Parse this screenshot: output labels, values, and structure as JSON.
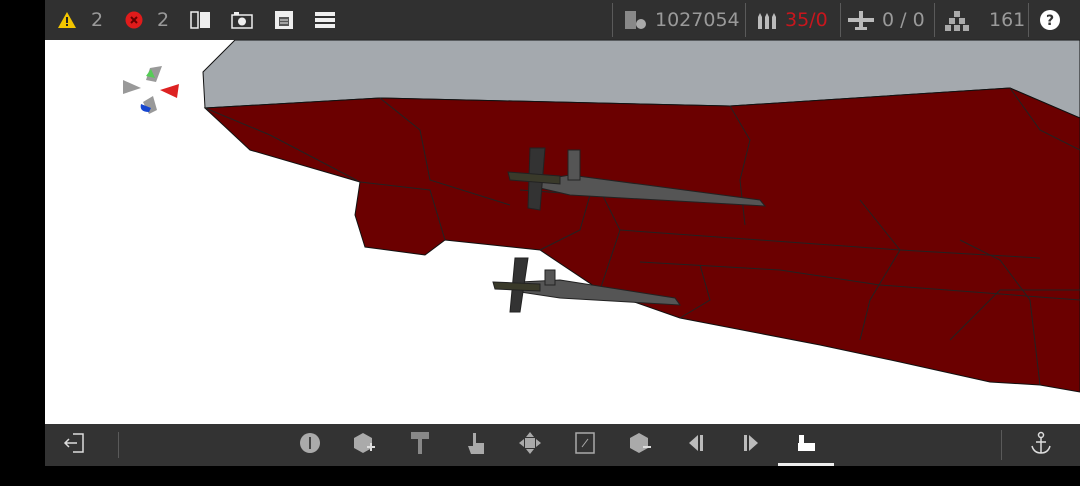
{
  "topbar": {
    "warnings": {
      "icon": "warning-icon",
      "count": "2",
      "color": "#f2c500"
    },
    "errors": {
      "icon": "error-icon",
      "count": "2",
      "color": "#e01b1b"
    },
    "tools": [
      "split-view-icon",
      "camera-icon",
      "save-icon",
      "menu-icon"
    ],
    "credits": {
      "icon": "coins-icon",
      "value": "1027054"
    },
    "ammo": {
      "icon": "ammo-icon",
      "value": "35/0",
      "color": "#c8161d"
    },
    "aircraft": {
      "icon": "plane-icon",
      "value": "0 / 0"
    },
    "parts": {
      "icon": "blocks-icon",
      "value": "161"
    },
    "help": {
      "icon": "help-icon"
    }
  },
  "bottombar": {
    "left": "exit-icon",
    "tools": [
      "info-icon",
      "add-block-icon",
      "paint-roller-icon",
      "hand-pointer-icon",
      "move-icon",
      "rotate-icon",
      "remove-block-icon",
      "previous-icon",
      "next-icon",
      "deploy-icon"
    ],
    "active_tool": "deploy-icon",
    "right": "anchor-icon"
  },
  "scene": {
    "hull_color": "#6b0000",
    "deck_color": "#a4a9ae"
  }
}
